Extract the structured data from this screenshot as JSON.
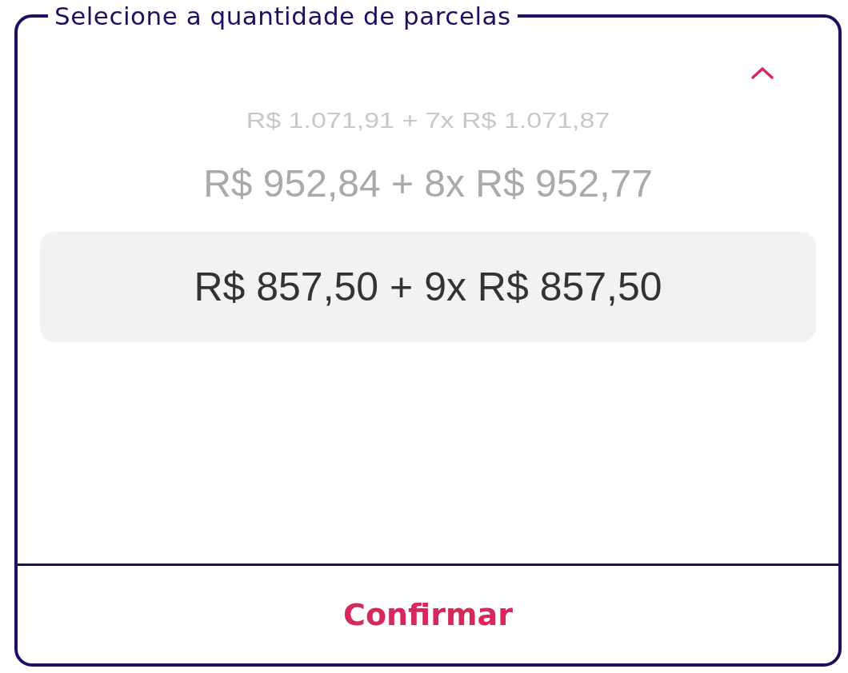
{
  "legend": "Selecione a quantidade de parcelas",
  "options": [
    {
      "label": "R$ 1.071,91 + 7x R$ 1.071,87",
      "selected": false
    },
    {
      "label": "R$ 952,84 + 8x R$ 952,77",
      "selected": false
    },
    {
      "label": "R$ 857,50 + 9x R$ 857,50",
      "selected": true
    }
  ],
  "confirm_button": "Confirmar"
}
